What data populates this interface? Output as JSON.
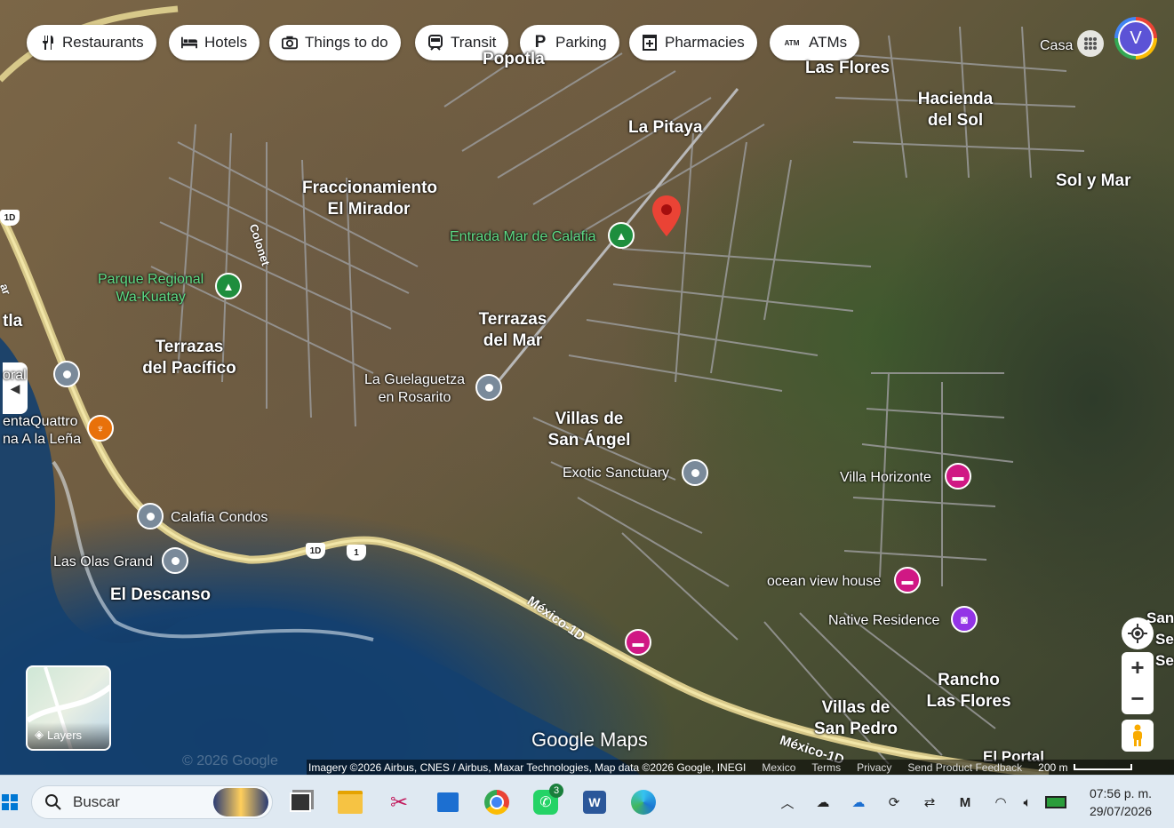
{
  "filter_chips": [
    {
      "label": "Restaurants",
      "icon": "fork-knife-icon"
    },
    {
      "label": "Hotels",
      "icon": "bed-icon"
    },
    {
      "label": "Things to do",
      "icon": "camera-icon"
    },
    {
      "label": "Transit",
      "icon": "train-icon"
    },
    {
      "label": "Parking",
      "icon": "parking-icon"
    },
    {
      "label": "Pharmacies",
      "icon": "pharmacy-icon"
    },
    {
      "label": "ATMs",
      "icon": "atm-icon"
    }
  ],
  "atm_icon_text": "ATM",
  "parking_icon_text": "P",
  "account": {
    "initial": "V"
  },
  "places": {
    "popotla": "Popotla",
    "las_flores": "Las Flores",
    "casa": "Casa",
    "la_pitaya": "La Pitaya",
    "hacienda_l1": "Hacienda",
    "hacienda_l2": "del Sol",
    "sol_y_mar": "Sol y Mar",
    "fracc_l1": "Fraccionamiento",
    "fracc_l2": "El Mirador",
    "terr_mar_l1": "Terrazas",
    "terr_mar_l2": "del Mar",
    "terr_pac_l1": "Terrazas",
    "terr_pac_l2": "del Pacífico",
    "villas_angel_l1": "Villas de",
    "villas_angel_l2": "San Ángel",
    "el_descanso": "El Descanso",
    "rancho_l1": "Rancho",
    "rancho_l2": "Las Flores",
    "villas_pedro_l1": "Villas de",
    "villas_pedro_l2": "San Pedro",
    "el_portal": "El Portal",
    "tla": "tla",
    "san_1": "San",
    "san_2": "Se",
    "san_3": "Se"
  },
  "pois": {
    "entrada_mar": "Entrada Mar de Calafia",
    "parque_l1": "Parque Regional",
    "parque_l2": "Wa-Kuatay",
    "guelaguetza_l1": "La Guelaguetza",
    "guelaguetza_l2": "en Rosarito",
    "exotic": "Exotic Sanctuary",
    "villa_horizonte": "Villa Horizonte",
    "calafia_condos": "Calafia Condos",
    "las_olas": "Las Olas Grand",
    "ocean_view": "ocean view house",
    "native": "Native Residence",
    "oral": "oral",
    "quattro_l1": "entaQuattro",
    "quattro_l2": "na A la Leña"
  },
  "roads": {
    "colonet": "Colonet",
    "mexico_1d_a": "México-1D",
    "mexico_1d_b": "México-1D",
    "shield_1d": "1D",
    "shield_1": "1",
    "shield_edge": "1D",
    "edge_ar": "ar"
  },
  "layers_label": "Layers",
  "watermark": "Google Maps",
  "watermark_faint": "© 2026 Google",
  "attribution": {
    "imagery": "Imagery ©2026 Airbus, CNES / Airbus, Maxar Technologies, Map data ©2026 Google, INEGI",
    "country": "Mexico",
    "terms": "Terms",
    "privacy": "Privacy",
    "feedback": "Send Product Feedback",
    "scale": "200 m"
  },
  "taskbar": {
    "search_placeholder": "Buscar",
    "whatsapp_badge": "3",
    "time": "07:56 p. m.",
    "date": "29/07/2026"
  },
  "colors": {
    "marker": "#ea4335",
    "hotel_pin": "#d01884",
    "park_pin": "#1e8e3e",
    "restaurant_pin": "#e8710a"
  }
}
